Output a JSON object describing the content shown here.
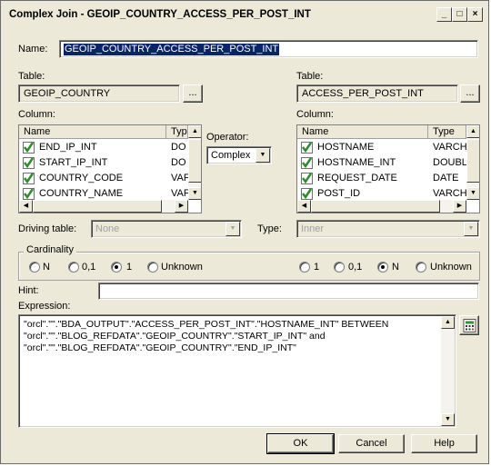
{
  "window": {
    "title": "Complex Join - GEOIP_COUNTRY_ACCESS_PER_POST_INT"
  },
  "name": {
    "label": "Name:",
    "value": "GEOIP_COUNTRY_ACCESS_PER_POST_INT"
  },
  "left": {
    "table_label": "Table:",
    "table_value": "GEOIP_COUNTRY",
    "browse_label": "...",
    "column_label": "Column:",
    "headers": [
      "Name",
      "Typ"
    ],
    "rows": [
      {
        "name": "END_IP_INT",
        "type": "DO"
      },
      {
        "name": "START_IP_INT",
        "type": "DO"
      },
      {
        "name": "COUNTRY_CODE",
        "type": "VAF"
      },
      {
        "name": "COUNTRY_NAME",
        "type": "VAF"
      }
    ]
  },
  "operator": {
    "label": "Operator:",
    "value": "Complex"
  },
  "right": {
    "table_label": "Table:",
    "table_value": "ACCESS_PER_POST_INT",
    "browse_label": "...",
    "column_label": "Column:",
    "headers": [
      "Name",
      "Type"
    ],
    "rows": [
      {
        "name": "HOSTNAME",
        "type": "VARCH"
      },
      {
        "name": "HOSTNAME_INT",
        "type": "DOUBL"
      },
      {
        "name": "REQUEST_DATE",
        "type": "DATE"
      },
      {
        "name": "POST_ID",
        "type": "VARCH"
      }
    ]
  },
  "driving": {
    "label": "Driving table:",
    "value": "None"
  },
  "type": {
    "label": "Type:",
    "value": "Inner"
  },
  "cardinality": {
    "label": "Cardinality",
    "left": [
      "N",
      "0,1",
      "1",
      "Unknown"
    ],
    "left_selected": 2,
    "right": [
      "1",
      "0,1",
      "N",
      "Unknown"
    ],
    "right_selected": 2
  },
  "hint": {
    "label": "Hint:",
    "value": ""
  },
  "expression": {
    "label": "Expression:",
    "lines": [
      "\"orcl\".\"\".\"BDA_OUTPUT\".\"ACCESS_PER_POST_INT\".\"HOSTNAME_INT\" BETWEEN",
      "\"orcl\".\"\".\"BLOG_REFDATA\".\"GEOIP_COUNTRY\".\"START_IP_INT\" and",
      "\"orcl\".\"\".\"BLOG_REFDATA\".\"GEOIP_COUNTRY\".\"END_IP_INT\""
    ]
  },
  "buttons": {
    "ok": "OK",
    "cancel": "Cancel",
    "help": "Help"
  },
  "titlebar_buttons": {
    "min": "_",
    "max": "□",
    "close": "×"
  },
  "colors": {
    "selection": "#0a246a",
    "check": "#2e8b2e"
  }
}
